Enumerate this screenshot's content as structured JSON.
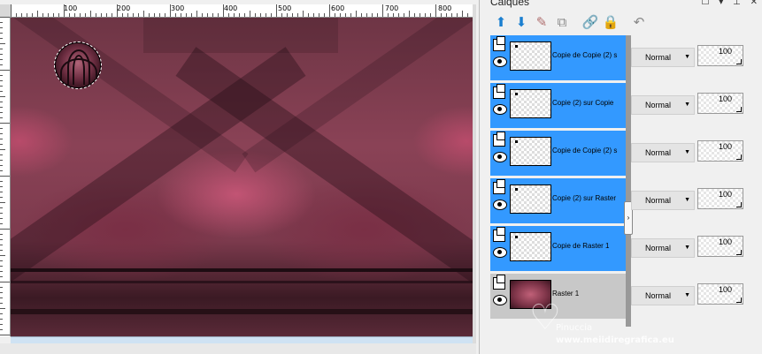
{
  "ruler": {
    "labels": [
      "100",
      "200",
      "300",
      "400",
      "500",
      "600",
      "700",
      "800"
    ]
  },
  "palette": {
    "title": "Calques",
    "controls": [
      "☐",
      "▾",
      "⊥",
      "✕"
    ],
    "toolbar_icons": [
      "arrange-up-icon",
      "arrange-down-icon",
      "brush-icon",
      "duplicate-icon",
      "link-icon",
      "lock-icon",
      "undo-icon"
    ]
  },
  "layers": [
    {
      "name": "Copie de Copie (2) s",
      "blend": "Normal",
      "opacity": "100",
      "selected": true
    },
    {
      "name": "Copie (2) sur Copie",
      "blend": "Normal",
      "opacity": "100",
      "selected": true
    },
    {
      "name": "Copie de Copie (2) s",
      "blend": "Normal",
      "opacity": "100",
      "selected": true
    },
    {
      "name": "Copie (2) sur Raster",
      "blend": "Normal",
      "opacity": "100",
      "selected": true
    },
    {
      "name": "Copie de Raster 1",
      "blend": "Normal",
      "opacity": "100",
      "selected": true
    },
    {
      "name": "Raster 1",
      "blend": "Normal",
      "opacity": "100",
      "selected": false
    }
  ],
  "watermark": {
    "name": "Pinuccia",
    "site": "www.meiidiregrafica.eu"
  },
  "colors": {
    "selection": "#3399ff",
    "unselected": "#c8c8c8",
    "canvas_tone": "#7c3a4d"
  }
}
